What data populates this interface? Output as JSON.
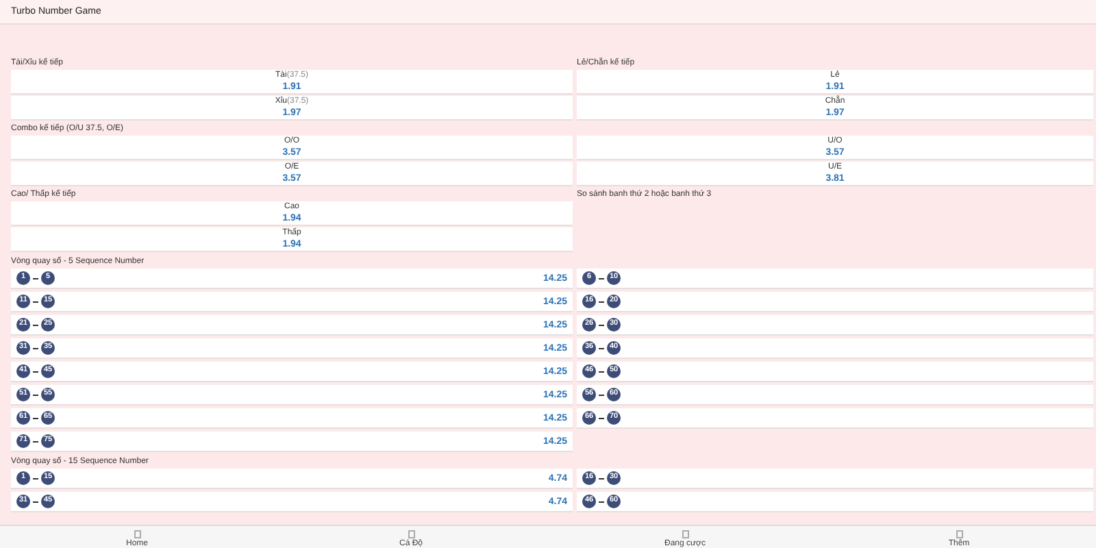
{
  "title": "Turbo Number Game",
  "market_rows": [
    {
      "left": {
        "title": "Tài/Xỉu kế tiếp",
        "options": [
          {
            "label": "Tài",
            "line": "(37.5)",
            "odds": "1.91"
          },
          {
            "label": "Xỉu",
            "line": "(37.5)",
            "odds": "1.97"
          }
        ]
      },
      "right": {
        "title": "Lẻ/Chẵn kế tiếp",
        "options": [
          {
            "label": "Lẻ",
            "odds": "1.91"
          },
          {
            "label": "Chẵn",
            "odds": "1.97"
          }
        ]
      }
    },
    {
      "left": {
        "title": "Combo kế tiếp (O/U 37.5, O/E)",
        "options": [
          {
            "label": "O/O",
            "odds": "3.57"
          },
          {
            "label": "O/E",
            "odds": "3.57"
          }
        ]
      },
      "right": {
        "options": [
          {
            "label": "U/O",
            "odds": "3.57"
          },
          {
            "label": "U/E",
            "odds": "3.81"
          }
        ]
      }
    },
    {
      "left": {
        "title": "Cao/ Thấp kế tiếp",
        "options": [
          {
            "label": "Cao",
            "odds": "1.94"
          },
          {
            "label": "Thấp",
            "odds": "1.94"
          }
        ]
      },
      "right": {
        "title": "So sánh banh thứ 2 hoặc banh thứ 3"
      }
    }
  ],
  "sequences": [
    {
      "title": "Vòng quay số - 5 Sequence Number",
      "left": [
        {
          "from": "1",
          "to": "5",
          "odds": "14.25"
        },
        {
          "from": "11",
          "to": "15",
          "odds": "14.25"
        },
        {
          "from": "21",
          "to": "25",
          "odds": "14.25"
        },
        {
          "from": "31",
          "to": "35",
          "odds": "14.25"
        },
        {
          "from": "41",
          "to": "45",
          "odds": "14.25"
        },
        {
          "from": "51",
          "to": "55",
          "odds": "14.25"
        },
        {
          "from": "61",
          "to": "65",
          "odds": "14.25"
        },
        {
          "from": "71",
          "to": "75",
          "odds": "14.25"
        }
      ],
      "right": [
        {
          "from": "6",
          "to": "10"
        },
        {
          "from": "16",
          "to": "20"
        },
        {
          "from": "26",
          "to": "30"
        },
        {
          "from": "36",
          "to": "40"
        },
        {
          "from": "46",
          "to": "50"
        },
        {
          "from": "56",
          "to": "60"
        },
        {
          "from": "66",
          "to": "70"
        }
      ]
    },
    {
      "title": "Vòng quay số - 15 Sequence Number",
      "left": [
        {
          "from": "1",
          "to": "15",
          "odds": "4.74"
        },
        {
          "from": "31",
          "to": "45",
          "odds": "4.74"
        }
      ],
      "right": [
        {
          "from": "16",
          "to": "30"
        },
        {
          "from": "46",
          "to": "60"
        }
      ]
    }
  ],
  "nav": [
    {
      "label": "Home"
    },
    {
      "label": "Cá Độ"
    },
    {
      "label": "Đang cược"
    },
    {
      "label": "Thêm"
    }
  ]
}
